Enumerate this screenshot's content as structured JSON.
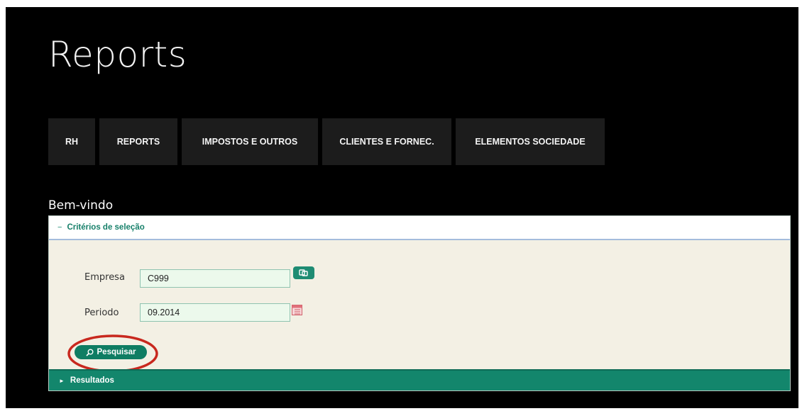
{
  "page": {
    "title": "Reports"
  },
  "nav": {
    "tabs": [
      {
        "label": "RH"
      },
      {
        "label": "REPORTS"
      },
      {
        "label": "IMPOSTOS E OUTROS"
      },
      {
        "label": "CLIENTES E FORNEC."
      },
      {
        "label": "ELEMENTOS SOCIEDADE"
      }
    ]
  },
  "welcome": "Bem-vindo",
  "criteria": {
    "toggle_icon": "−",
    "title": "Critérios de seleção",
    "empresa": {
      "label": "Empresa",
      "value": "C999"
    },
    "periodo": {
      "label": "Periodo",
      "value": "09.2014"
    },
    "search_button": {
      "label": "Pesquisar",
      "icon": "magnifier-icon"
    }
  },
  "results": {
    "toggle_icon": "►",
    "title": "Resultados"
  },
  "colors": {
    "background": "#000000",
    "accent_green": "#13866c",
    "highlight_red": "#c8281e",
    "panel_bg": "#f3f0e4",
    "input_bg": "#ecf9ec"
  }
}
